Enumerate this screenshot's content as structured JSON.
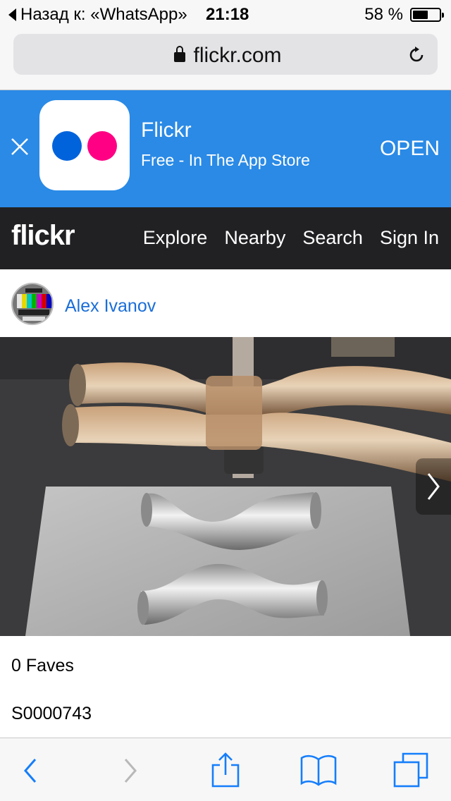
{
  "status_bar": {
    "back_label": "Назад к: «WhatsApp»",
    "time": "21:18",
    "battery_percent": "58 %",
    "battery_level": 0.58
  },
  "browser": {
    "url": "flickr.com"
  },
  "app_banner": {
    "title": "Flickr",
    "subtitle": "Free - In The App Store",
    "open_label": "OPEN"
  },
  "nav": {
    "logo": "flickr",
    "links": [
      "Explore",
      "Nearby",
      "Search",
      "Sign In"
    ]
  },
  "photo_page": {
    "author": "Alex Ivanov",
    "faves": "0 Faves",
    "title": "S0000743"
  },
  "colors": {
    "banner_bg": "#2a8ae6",
    "flickr_blue": "#0063dc",
    "flickr_pink": "#ff0084",
    "nav_bg": "#212124",
    "link": "#1a6ed8",
    "ios_blue": "#157efb"
  },
  "icons": {
    "toolbar": [
      "back-icon",
      "forward-icon",
      "share-icon",
      "bookmarks-icon",
      "tabs-icon"
    ]
  }
}
